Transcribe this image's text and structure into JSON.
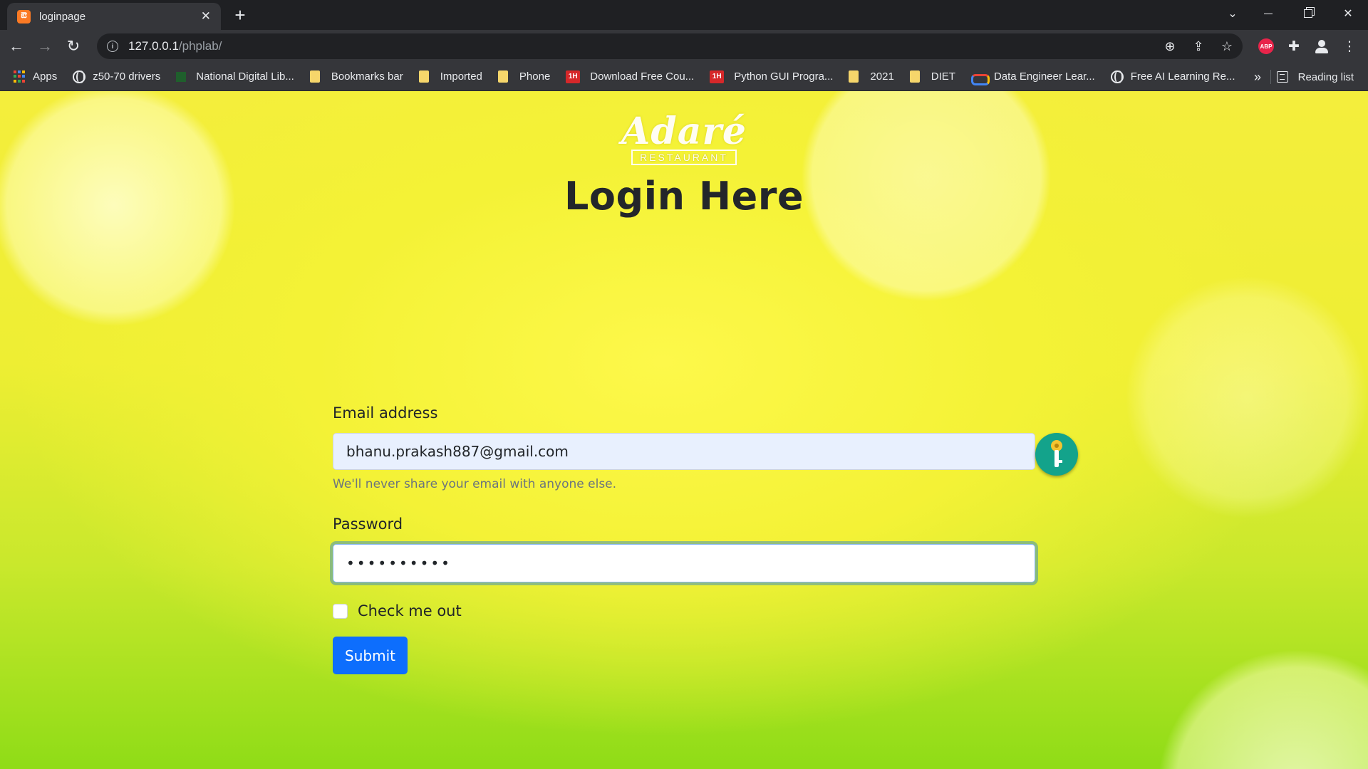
{
  "browser": {
    "tab": {
      "favicon": "xampp-icon",
      "favicon_text": "ఔ",
      "title": "loginpage"
    },
    "url_host": "127.0.0.1",
    "url_path": "/phplab/",
    "bookmarks": [
      {
        "label": "Apps",
        "icon": "apps-grid-icon"
      },
      {
        "label": "z50-70 drivers",
        "icon": "globe-icon"
      },
      {
        "label": "National Digital Lib...",
        "icon": "ndl-icon"
      },
      {
        "label": "Bookmarks bar",
        "icon": "folder-icon"
      },
      {
        "label": "Imported",
        "icon": "folder-icon"
      },
      {
        "label": "Phone",
        "icon": "folder-icon"
      },
      {
        "label": "Download Free Cou...",
        "icon": "oneh-icon",
        "icon_text": "1H"
      },
      {
        "label": "Python GUI Progra...",
        "icon": "oneh-icon",
        "icon_text": "1H"
      },
      {
        "label": "2021",
        "icon": "folder-icon"
      },
      {
        "label": "DIET",
        "icon": "folder-icon"
      },
      {
        "label": "Data Engineer Lear...",
        "icon": "google-cloud-icon"
      },
      {
        "label": "Free AI Learning Re...",
        "icon": "globe-icon"
      }
    ],
    "more_bookmarks": "»",
    "reading_list": "Reading list",
    "extension_abp": "ABP"
  },
  "page": {
    "logo": {
      "script": "Adaré",
      "sub": "RESTAURANT"
    },
    "heading": "Login Here",
    "email": {
      "label": "Email address",
      "value": "bhanu.prakash887@gmail.com",
      "help": "We'll never share your email with anyone else."
    },
    "password": {
      "label": "Password",
      "value": "••••••••••"
    },
    "checkbox_label": "Check me out",
    "submit_label": "Submit"
  },
  "colors": {
    "primary": "#0d6efd",
    "key_badge": "#13a38b",
    "tab_bg": "#35363a"
  }
}
